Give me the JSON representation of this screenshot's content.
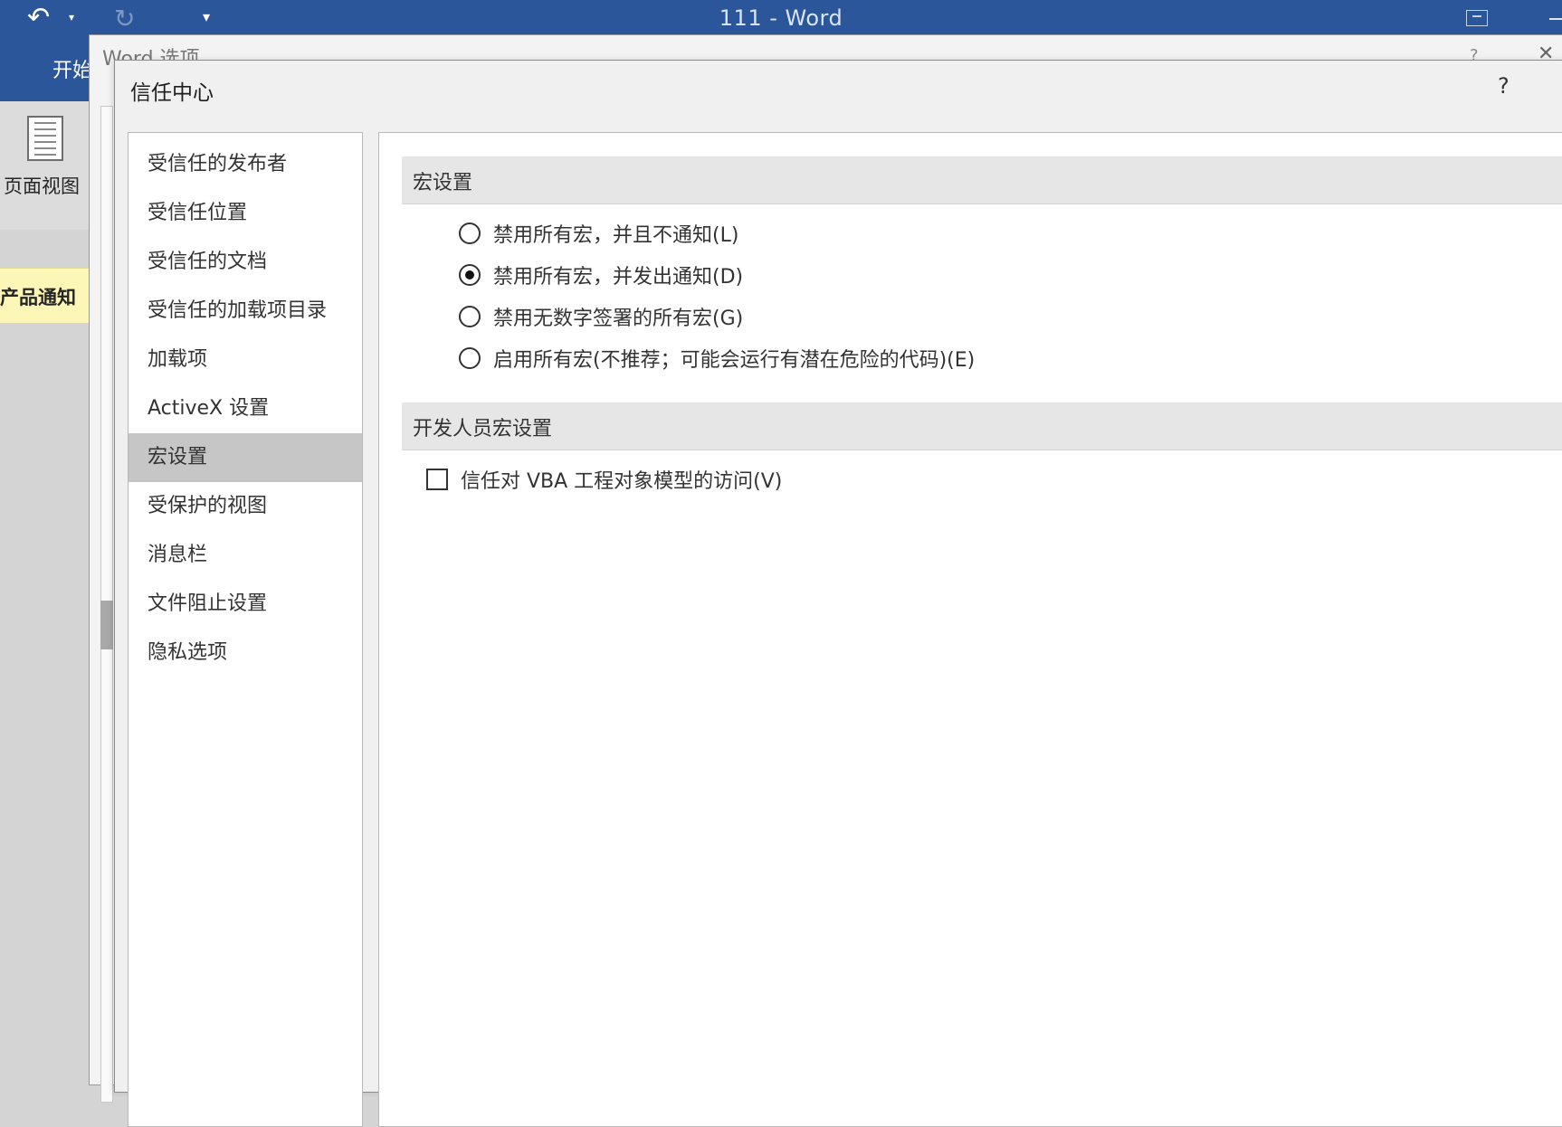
{
  "word": {
    "window_title": "111 - Word",
    "tab_home": "开始",
    "page_view_label": "页面视图",
    "notice_label": "产品通知"
  },
  "word_options": {
    "title": "Word 选项",
    "help": "?",
    "close": "✕"
  },
  "trust_center": {
    "title": "信任中心",
    "help": "?",
    "nav": [
      {
        "label": "受信任的发布者",
        "selected": false
      },
      {
        "label": "受信任位置",
        "selected": false
      },
      {
        "label": "受信任的文档",
        "selected": false
      },
      {
        "label": "受信任的加载项目录",
        "selected": false
      },
      {
        "label": "加载项",
        "selected": false
      },
      {
        "label": "ActiveX 设置",
        "selected": false
      },
      {
        "label": "宏设置",
        "selected": true
      },
      {
        "label": "受保护的视图",
        "selected": false
      },
      {
        "label": "消息栏",
        "selected": false
      },
      {
        "label": "文件阻止设置",
        "selected": false
      },
      {
        "label": "隐私选项",
        "selected": false
      }
    ],
    "macro_section": {
      "title": "宏设置",
      "options": [
        {
          "label": "禁用所有宏，并且不通知(L)",
          "checked": false
        },
        {
          "label": "禁用所有宏，并发出通知(D)",
          "checked": true
        },
        {
          "label": "禁用无数字签署的所有宏(G)",
          "checked": false
        },
        {
          "label": "启用所有宏(不推荐；可能会运行有潜在危险的代码)(E)",
          "checked": false
        }
      ]
    },
    "dev_section": {
      "title": "开发人员宏设置",
      "checkbox_label": "信任对 VBA 工程对象模型的访问(V)",
      "checked": false
    }
  }
}
